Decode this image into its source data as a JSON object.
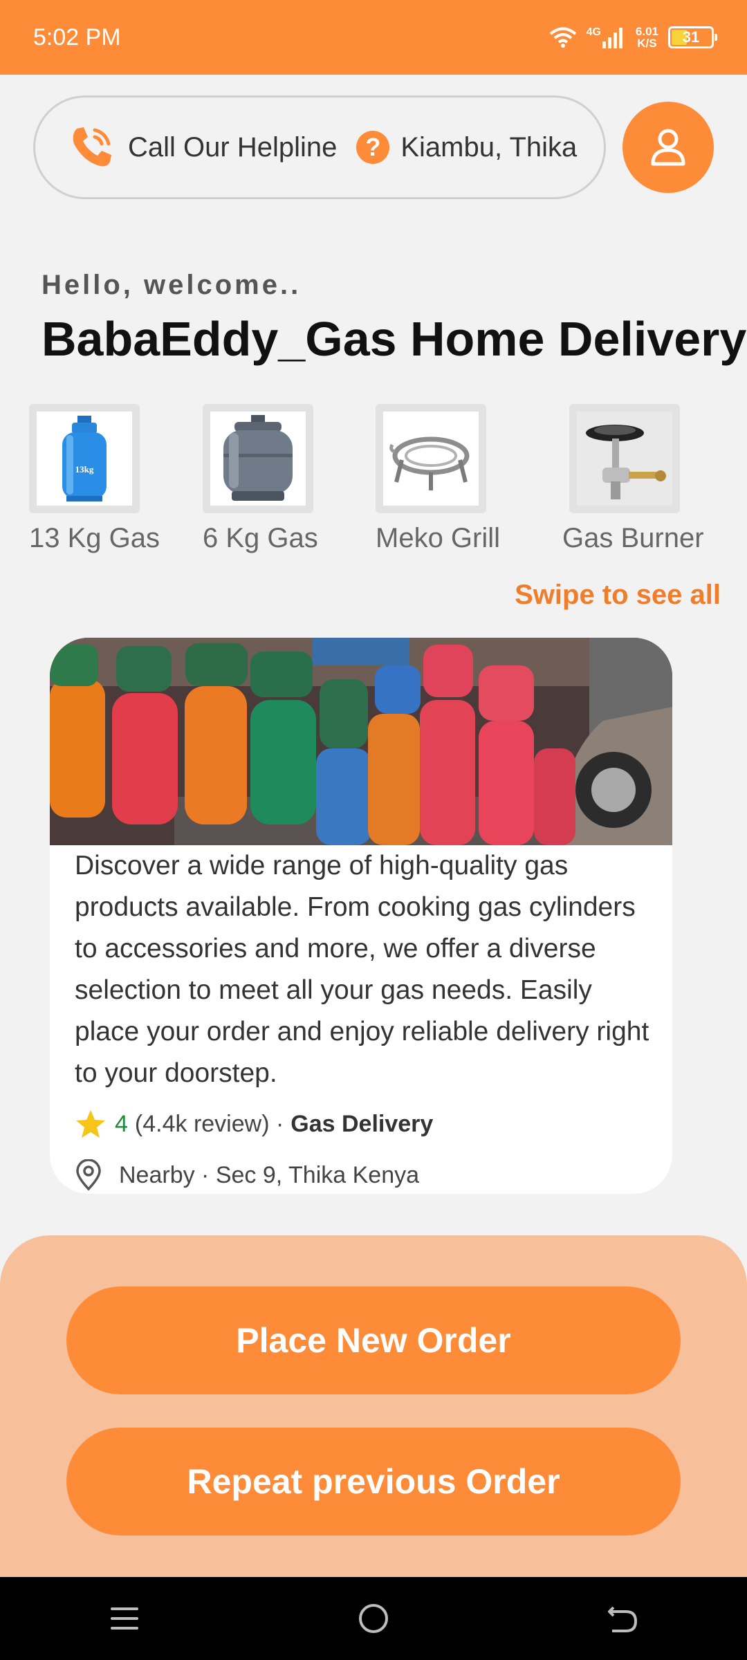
{
  "status_bar": {
    "time": "5:02 PM",
    "net_type": "4G",
    "net_speed_value": "6.01",
    "net_speed_unit": "K/S",
    "battery": "31"
  },
  "header": {
    "helpline_label": "Call Our Helpline",
    "location": "Kiambu, Thika",
    "help_icon_glyph": "?"
  },
  "greeting": {
    "small": "Hello, welcome..",
    "title": "BabaEddy_Gas Home Delivery"
  },
  "categories": [
    {
      "label": "13 Kg Gas",
      "icon": "blue-gas-cylinder"
    },
    {
      "label": "6 Kg Gas",
      "icon": "grey-gas-cylinder"
    },
    {
      "label": "Meko Grill",
      "icon": "meko-grill"
    },
    {
      "label": "Gas Burner",
      "icon": "gas-burner"
    }
  ],
  "cylinder_label": "13kg",
  "swipe_label": "Swipe to see all",
  "card": {
    "description": "Discover a wide range of high-quality gas products available. From cooking gas cylinders to accessories and more, we offer a diverse selection to meet all your gas needs. Easily place your order and enjoy reliable delivery right to your doorstep.",
    "rating": "4",
    "reviews": "(4.4k review) ·",
    "category": "Gas Delivery",
    "location": "Nearby · Sec 9, Thika Kenya"
  },
  "buttons": {
    "place_new": "Place New Order",
    "repeat": "Repeat previous Order"
  },
  "colors": {
    "accent": "#fd8b37",
    "panel": "#f7c09b",
    "rating_green": "#1f8a3a"
  }
}
